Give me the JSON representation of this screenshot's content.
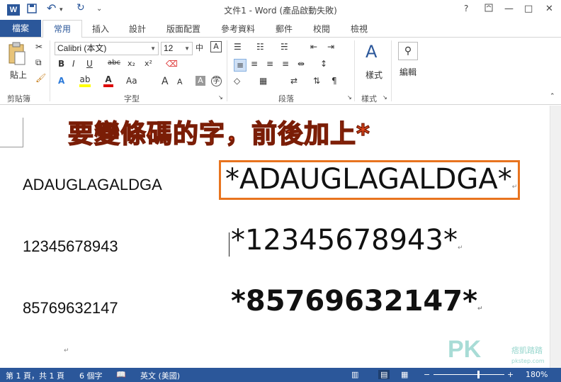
{
  "app": {
    "title": "文件1 - Word (產品啟動失敗)",
    "icon_letter": "W",
    "help": "?",
    "restore": "▢",
    "minimize": "—",
    "maximize": "□",
    "close": "✕"
  },
  "quick_access": {
    "save": "💾",
    "undo": "↶",
    "redo": "↻",
    "customize": "⌄"
  },
  "tabs": {
    "file": "檔案",
    "items": [
      "常用",
      "插入",
      "設計",
      "版面配置",
      "參考資料",
      "郵件",
      "校閱",
      "檢視"
    ]
  },
  "ribbon": {
    "clipboard": {
      "paste": "貼上",
      "label": "剪貼簿"
    },
    "font": {
      "name": "Calibri (本文)",
      "size": "12",
      "label": "字型",
      "bold": "B",
      "italic": "I",
      "underline": "U",
      "strike": "abc",
      "subscript": "x₂",
      "superscript": "x²"
    },
    "paragraph": {
      "label": "段落"
    },
    "styles": {
      "button": "樣式",
      "label": "樣式"
    },
    "editing": {
      "button": "編輯"
    }
  },
  "document": {
    "heading": "要變條碼的字，前後加上*",
    "rows": [
      {
        "plain": "ADAUGLAGALDGA",
        "barcode": "*ADAUGLAGALDGA*"
      },
      {
        "plain": "12345678943",
        "barcode": "*12345678943*"
      },
      {
        "plain": "85769632147",
        "barcode": "*85769632147*"
      }
    ],
    "para_mark": "↵"
  },
  "status": {
    "page": "第 1 頁，共 1 頁",
    "words": "6 個字",
    "language": "英文 (美國)",
    "zoom": "180%"
  },
  "watermark": {
    "brand": "PK",
    "sub": "痞凱踏踏",
    "url": "pkstep.com"
  }
}
